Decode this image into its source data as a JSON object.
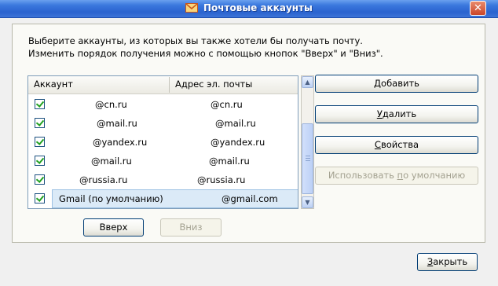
{
  "window": {
    "title": "Почтовые аккаунты",
    "close_glyph": "✕"
  },
  "instructions": {
    "line1": "Выберите аккаунты, из которых вы также хотели бы получать почту.",
    "line2": "Изменить порядок получения можно с помощью кнопок \"Вверх\" и \"Вниз\"."
  },
  "list": {
    "columns": {
      "account": "Аккаунт",
      "address": "Адрес эл. почты"
    },
    "rows": [
      {
        "account": "@cn.ru",
        "address": "@cn.ru",
        "checked": true
      },
      {
        "account": "@mail.ru",
        "address": "@mail.ru",
        "checked": true
      },
      {
        "account": "@yandex.ru",
        "address": "@yandex.ru",
        "checked": true
      },
      {
        "account": "@mail.ru",
        "address": "@mail.ru",
        "checked": true
      },
      {
        "account": "@russia.ru",
        "address": "@russia.ru",
        "checked": true
      },
      {
        "account": "Gmail (по умолчанию)",
        "address": "@gmail.com",
        "checked": true,
        "selected": true
      }
    ]
  },
  "buttons": {
    "add": {
      "pre": "",
      "u": "Д",
      "post": "обавить"
    },
    "delete": {
      "pre": "",
      "u": "У",
      "post": "далить"
    },
    "properties": {
      "pre": "",
      "u": "С",
      "post": "войства"
    },
    "default": {
      "pre": "Использовать ",
      "u": "п",
      "post": "о умолчанию"
    },
    "up": "Вверх",
    "down": "Вниз",
    "close": {
      "pre": "",
      "u": "З",
      "post": "акрыть"
    }
  }
}
